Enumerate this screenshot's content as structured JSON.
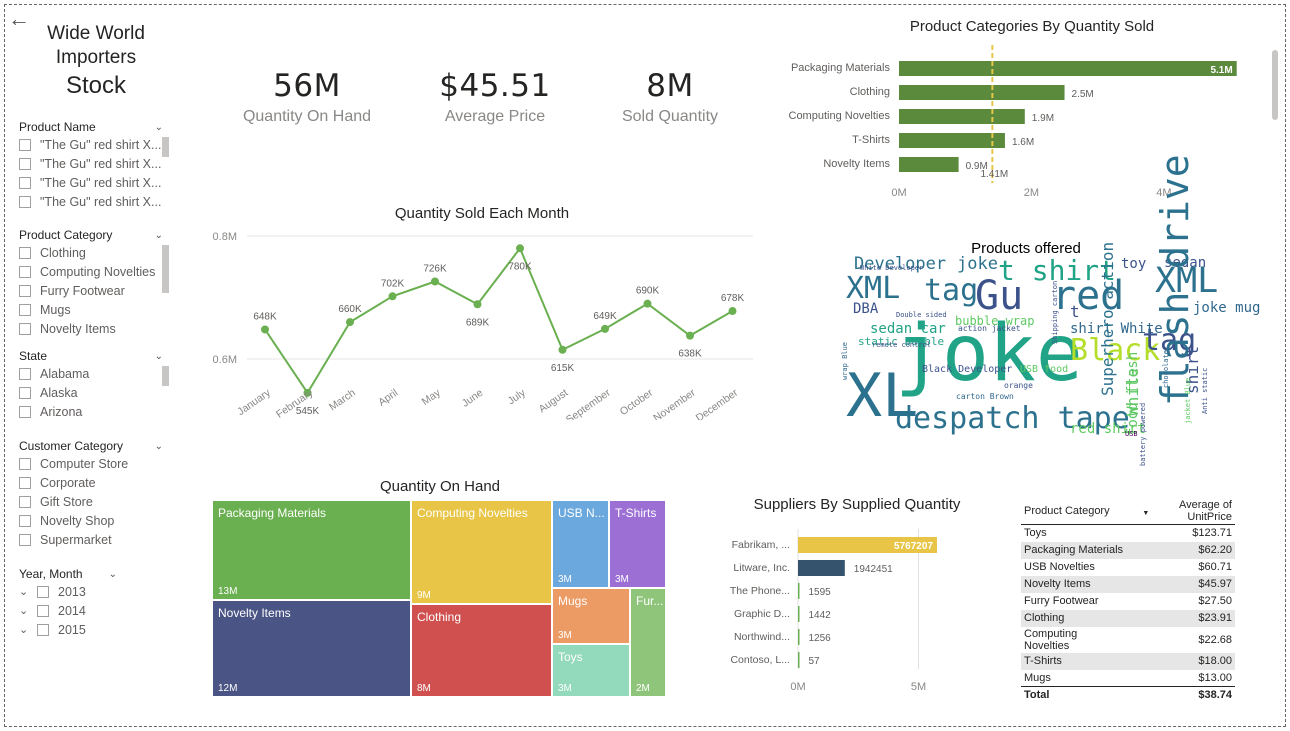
{
  "header": {
    "back_icon": "arrow-left-icon",
    "title_line1": "Wide World",
    "title_line2": "Importers",
    "title_line3": "Stock"
  },
  "slicers": {
    "product_name": {
      "label": "Product Name",
      "items": [
        "\"The Gu\" red shirt X...",
        "\"The Gu\" red shirt X...",
        "\"The Gu\" red shirt X...",
        "\"The Gu\" red shirt X..."
      ]
    },
    "product_category": {
      "label": "Product Category",
      "items": [
        "Clothing",
        "Computing Novelties",
        "Furry Footwear",
        "Mugs",
        "Novelty Items"
      ]
    },
    "state": {
      "label": "State",
      "items": [
        "Alabama",
        "Alaska",
        "Arizona"
      ]
    },
    "customer_category": {
      "label": "Customer Category",
      "items": [
        "Computer Store",
        "Corporate",
        "Gift Store",
        "Novelty Shop",
        "Supermarket"
      ]
    },
    "year_month": {
      "label": "Year, Month",
      "items": [
        "2013",
        "2014",
        "2015"
      ]
    }
  },
  "kpis": [
    {
      "value": "56M",
      "label": "Quantity On Hand"
    },
    {
      "value": "$45.51",
      "label": "Average Price"
    },
    {
      "value": "8M",
      "label": "Sold Quantity"
    }
  ],
  "colors": {
    "green": "#5b8a3c",
    "line": "#6aaf50",
    "yellow": "#e8c547",
    "navy": "#36536e"
  },
  "chart_data": [
    {
      "type": "bar",
      "title": "Product Categories By Quantity Sold",
      "orientation": "horizontal",
      "categories": [
        "Packaging Materials",
        "Clothing",
        "Computing Novelties",
        "T-Shirts",
        "Novelty Items"
      ],
      "values": [
        5.1,
        2.5,
        1.9,
        1.6,
        0.9
      ],
      "labels": [
        "5.1M",
        "2.5M",
        "1.9M",
        "1.6M",
        "0.9M"
      ],
      "reference_line": {
        "value": 1.41,
        "label": "1.41M"
      },
      "xticks": [
        "0M",
        "2M",
        "4M"
      ],
      "xlim": [
        0,
        5.15
      ]
    },
    {
      "type": "line",
      "title": "Quantity Sold Each Month",
      "categories": [
        "January",
        "February",
        "March",
        "April",
        "May",
        "June",
        "July",
        "August",
        "September",
        "October",
        "November",
        "December"
      ],
      "values": [
        648,
        545,
        660,
        702,
        726,
        689,
        780,
        615,
        649,
        690,
        638,
        678
      ],
      "labels": [
        "648K",
        "545K",
        "660K",
        "702K",
        "726K",
        "689K",
        "780K",
        "615K",
        "649K",
        "690K",
        "638K",
        "678K"
      ],
      "yticks": [
        "0.8M",
        "0.6M"
      ],
      "ylim": [
        530,
        800
      ]
    },
    {
      "type": "treemap",
      "title": "Quantity On Hand",
      "items": [
        {
          "name": "Packaging Materials",
          "value": "13M",
          "color": "#6aaf50"
        },
        {
          "name": "Novelty Items",
          "value": "12M",
          "color": "#4a5585"
        },
        {
          "name": "Computing Novelties",
          "value": "9M",
          "color": "#e8c547"
        },
        {
          "name": "Clothing",
          "value": "8M",
          "color": "#d05050"
        },
        {
          "name": "USB N...",
          "value": "3M",
          "color": "#6aa8de"
        },
        {
          "name": "T-Shirts",
          "value": "3M",
          "color": "#9b6fd4"
        },
        {
          "name": "Mugs",
          "value": "3M",
          "color": "#ec9b64"
        },
        {
          "name": "Toys",
          "value": "3M",
          "color": "#93d9bb"
        },
        {
          "name": "Fur...",
          "value": "2M",
          "color": "#8fc57a"
        }
      ]
    },
    {
      "type": "bar",
      "title": "Suppliers By Supplied Quantity",
      "orientation": "horizontal",
      "categories": [
        "Fabrikam, ...",
        "Litware, Inc.",
        "The Phone...",
        "Graphic D...",
        "Northwind...",
        "Contoso, L..."
      ],
      "values": [
        5767207,
        1942451,
        1595,
        1442,
        1256,
        57
      ],
      "labels": [
        "5767207",
        "1942451",
        "1595",
        "1442",
        "1256",
        "57"
      ],
      "colors": [
        "#e8c547",
        "#36536e",
        "#6aaf50",
        "#6aaf50",
        "#6aaf50",
        "#6aaf50"
      ],
      "xticks": [
        "0M",
        "5M"
      ],
      "xlim": [
        0,
        6100000
      ]
    },
    {
      "type": "table",
      "title": "",
      "columns": [
        "Product Category",
        "Average of UnitPrice"
      ],
      "rows": [
        [
          "Toys",
          "$123.71"
        ],
        [
          "Packaging Materials",
          "$62.20"
        ],
        [
          "USB Novelties",
          "$60.71"
        ],
        [
          "Novelty Items",
          "$45.97"
        ],
        [
          "Furry Footwear",
          "$27.50"
        ],
        [
          "Clothing",
          "$23.91"
        ],
        [
          "Computing Novelties",
          "$22.68"
        ],
        [
          "T-Shirts",
          "$18.00"
        ],
        [
          "Mugs",
          "$13.00"
        ]
      ],
      "total": [
        "Total",
        "$38.74"
      ]
    }
  ],
  "wordcloud": {
    "title": "Products offered",
    "words": [
      "Developer",
      "joke",
      "t shirt",
      "toy",
      "sedan",
      "XML",
      "tag",
      "Gu",
      "red",
      "XML",
      "DBA",
      "joke",
      "Black",
      "tag",
      "t",
      "bubble wrap",
      "shirt White",
      "sedan car",
      "XL",
      "joke mug",
      "flash drive",
      "shirt",
      "despatch tape",
      "red shirt",
      "White",
      "USB food",
      "Black Developer",
      "White Developer",
      "Double sided",
      "action jacket",
      "carton Brown",
      "static bubble",
      "Superhero action",
      "food flash",
      "USB",
      "chocolate",
      "Anti static",
      "remote control",
      "wrap Blue",
      "Shipping carton",
      "battery powered",
      "jacket Blue",
      "orange"
    ]
  }
}
